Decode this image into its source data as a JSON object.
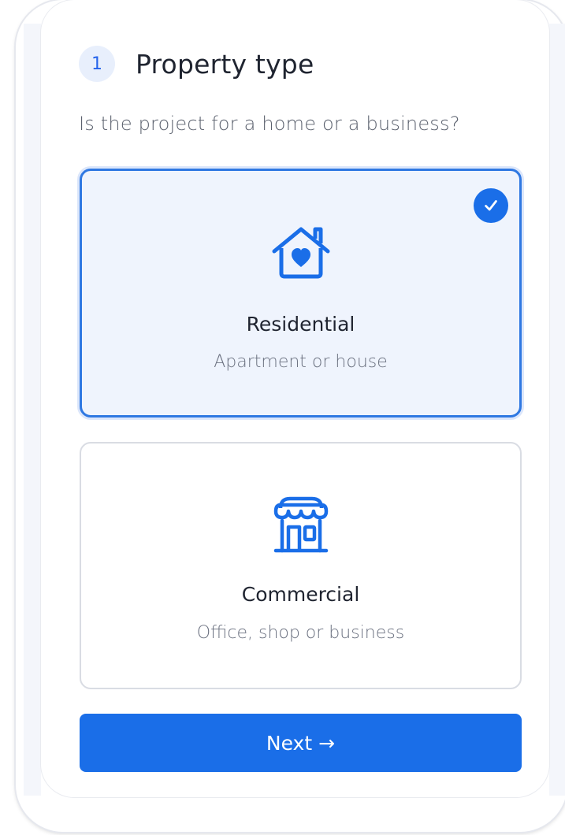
{
  "step": {
    "number": "1",
    "title": "Property type"
  },
  "question": "Is the project for a home or a business?",
  "options": [
    {
      "title": "Residential",
      "subtitle": "Apartment or house",
      "icon": "house-heart-icon",
      "selected": true
    },
    {
      "title": "Commercial",
      "subtitle": "Office, shop or business",
      "icon": "storefront-icon",
      "selected": false
    }
  ],
  "next_button": {
    "label": "Next",
    "arrow": "→"
  },
  "colors": {
    "accent": "#1a6ee8",
    "selected_bg": "#eff4fd",
    "selected_border": "#2f78e2",
    "badge_bg": "#e8effc"
  }
}
